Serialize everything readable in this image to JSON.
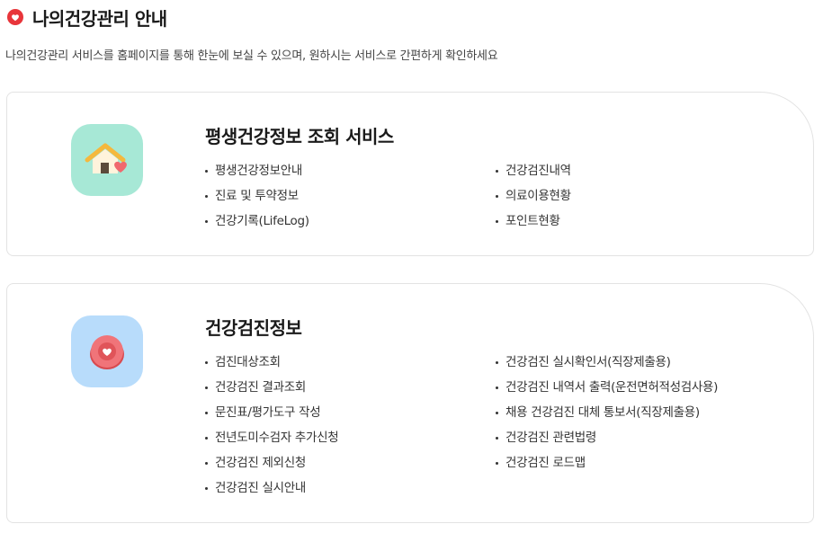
{
  "header": {
    "icon": "heart-badge-icon",
    "title": "나의건강관리 안내",
    "accent": "#e8353a"
  },
  "description": "나의건강관리 서비스를 홈페이지를 통해 한눈에 보실 수 있으며, 원하시는 서비스로 간편하게 확인하세요",
  "sections": [
    {
      "icon": "house-heart-icon",
      "badge_color": "#a7e8d6",
      "title": "평생건강정보 조회 서비스",
      "left_items": [
        "평생건강정보안내",
        "진료 및 투약정보",
        "건강기록(LifeLog)"
      ],
      "right_items": [
        "건강검진내역",
        "의료이용현황",
        "포인트현황"
      ]
    },
    {
      "icon": "heart-button-icon",
      "badge_color": "#b8dcfb",
      "title": "건강검진정보",
      "left_items": [
        "검진대상조회",
        "건강검진 결과조회",
        "문진표/평가도구 작성",
        "전년도미수검자 추가신청",
        "건강검진 제외신청",
        "건강검진 실시안내"
      ],
      "right_items": [
        "건강검진 실시확인서(직장제출용)",
        "건강검진 내역서 출력(운전면허적성검사용)",
        "채용 건강검진 대체 통보서(직장제출용)",
        "건강검진 관련법령",
        "건강검진 로드맵"
      ]
    }
  ]
}
